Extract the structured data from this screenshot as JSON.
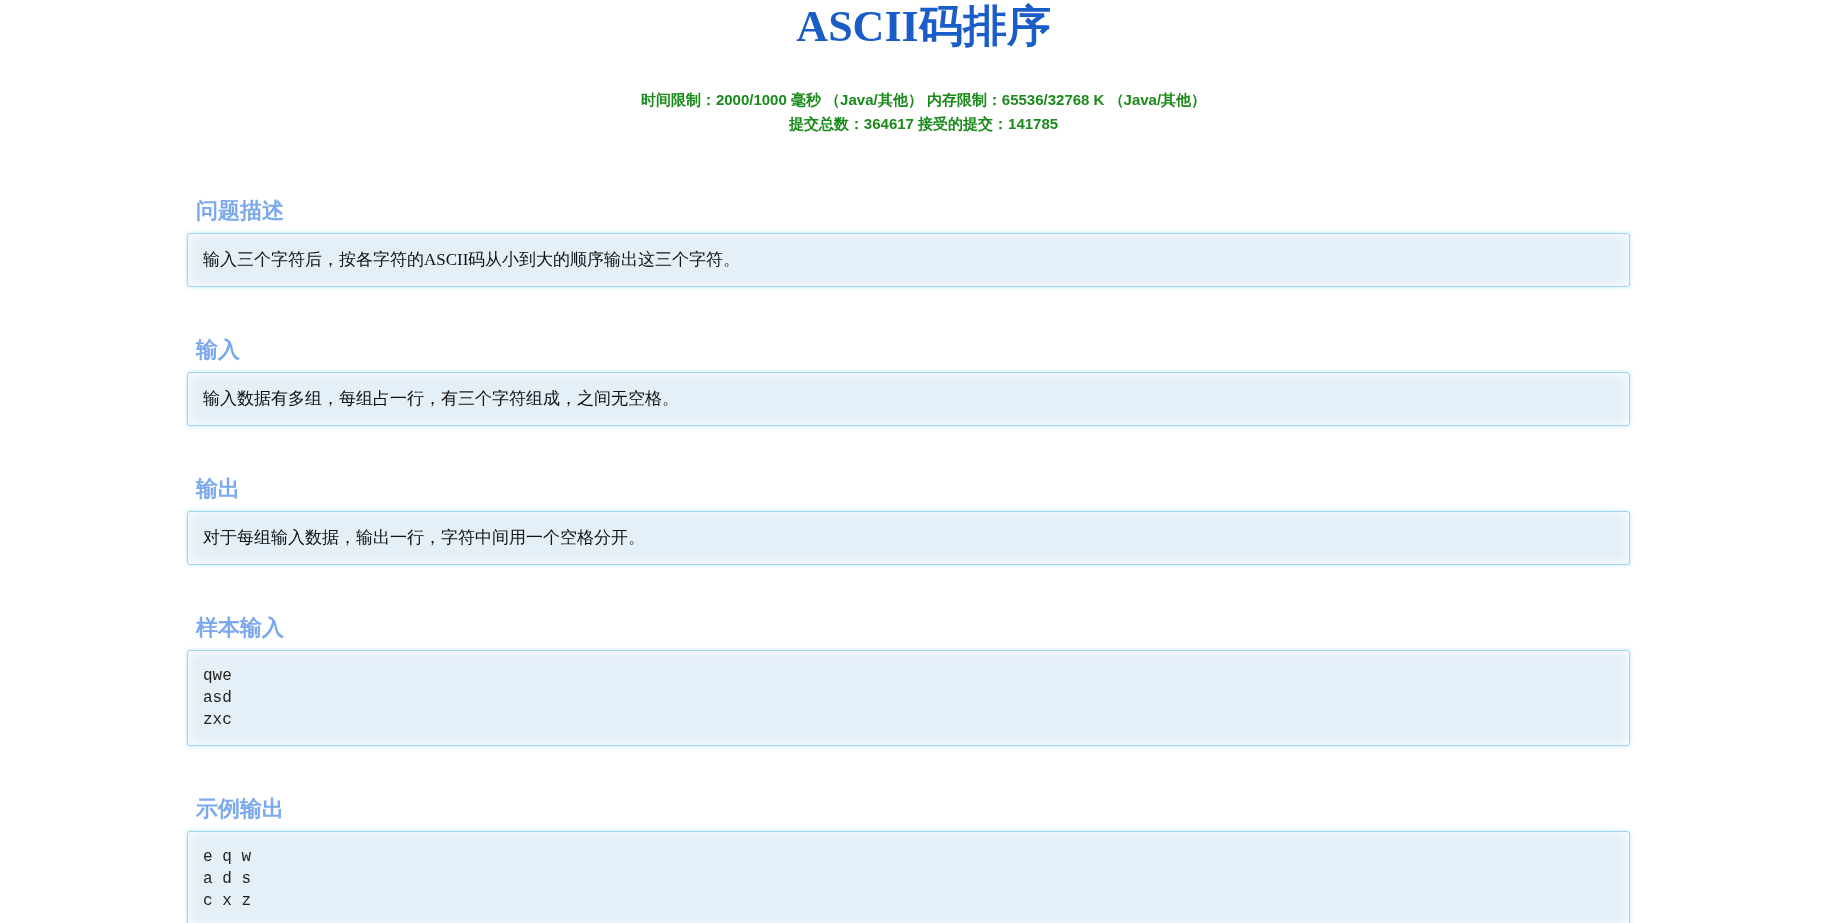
{
  "title": "ASCII码排序",
  "limits": [
    "时间限制：2000/1000 毫秒 （Java/其他） 内存限制：65536/32768 K （Java/其他）",
    "提交总数：364617 接受的提交：141785"
  ],
  "sections": [
    {
      "heading": "问题描述",
      "kind": "text",
      "lines": [
        "输入三个字符后，按各字符的ASCII码从小到大的顺序输出这三个字符。"
      ]
    },
    {
      "heading": "输入",
      "kind": "text",
      "lines": [
        "输入数据有多组，每组占一行，有三个字符组成，之间无空格。"
      ]
    },
    {
      "heading": "输出",
      "kind": "text",
      "lines": [
        "对于每组输入数据，输出一行，字符中间用一个空格分开。"
      ]
    },
    {
      "heading": "样本输入",
      "kind": "code",
      "lines": [
        "qwe",
        "asd",
        "zxc"
      ]
    },
    {
      "heading": "示例输出",
      "kind": "code",
      "lines": [
        "e q w",
        "a d s",
        "c x z"
      ]
    }
  ]
}
